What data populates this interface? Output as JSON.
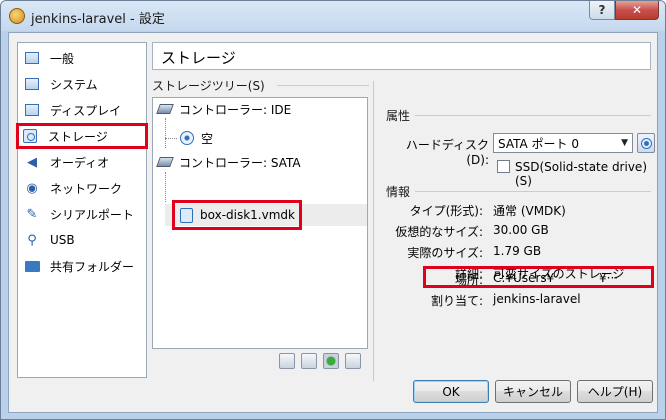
{
  "window": {
    "title": "jenkins-laravel - 設定",
    "help_glyph": "?",
    "close_glyph": "✕"
  },
  "sidebar": {
    "items": [
      {
        "label": "一般",
        "icon": "general-icon"
      },
      {
        "label": "システム",
        "icon": "system-icon"
      },
      {
        "label": "ディスプレイ",
        "icon": "display-icon"
      },
      {
        "label": "ストレージ",
        "icon": "storage-icon",
        "selected": true
      },
      {
        "label": "オーディオ",
        "icon": "audio-icon"
      },
      {
        "label": "ネットワーク",
        "icon": "network-icon"
      },
      {
        "label": "シリアルポート",
        "icon": "serial-port-icon"
      },
      {
        "label": "USB",
        "icon": "usb-icon"
      },
      {
        "label": "共有フォルダー",
        "icon": "shared-folder-icon"
      }
    ]
  },
  "page": {
    "title": "ストレージ"
  },
  "storage_tree": {
    "group_label": "ストレージツリー(S)",
    "controller_ide": "コントローラー: IDE",
    "ide_child": "空",
    "controller_sata": "コントローラー: SATA",
    "sata_child": "box-disk1.vmdk"
  },
  "attributes": {
    "group_label": "属性",
    "hard_disk_label": "ハードディスク(D):",
    "hard_disk_value": "SATA ポート 0",
    "ssd_label": "SSD(Solid-state drive)(S)",
    "ssd_checked": false
  },
  "info": {
    "group_label": "情報",
    "rows": [
      {
        "label": "タイプ(形式):",
        "value": "通常 (VMDK)"
      },
      {
        "label": "仮想的なサイズ:",
        "value": "30.00 GB"
      },
      {
        "label": "実際のサイズ:",
        "value": "1.79 GB"
      },
      {
        "label": "詳細:",
        "value": "可変サイズのストレージ"
      },
      {
        "label": "場所:",
        "value": "C:¥Users¥",
        "value_tail": "¥···"
      },
      {
        "label": "割り当て:",
        "value": "jenkins-laravel"
      }
    ]
  },
  "buttons": {
    "ok": "OK",
    "cancel": "キャンセル",
    "help": "ヘルプ(H)"
  },
  "colors": {
    "highlight": "#e0001b",
    "window_frame": "#b9d1ea"
  }
}
